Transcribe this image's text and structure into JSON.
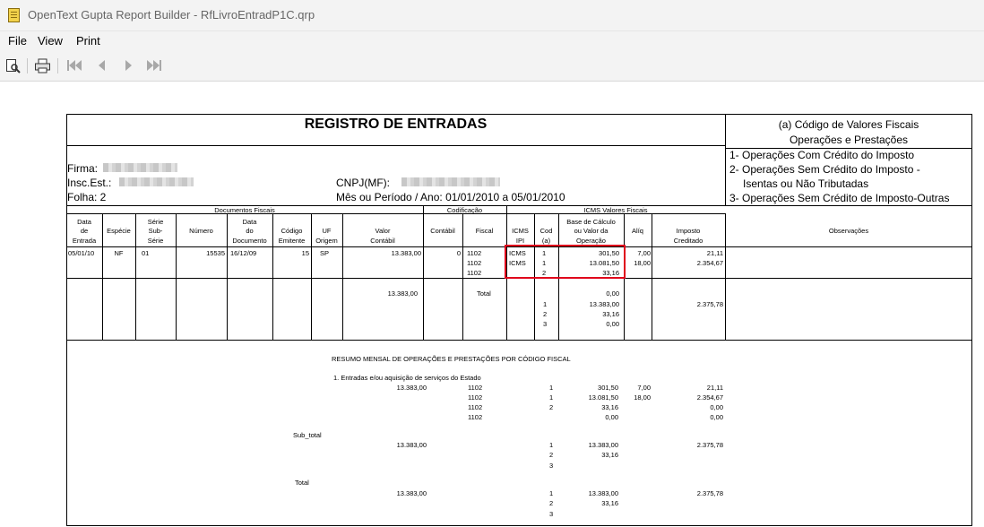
{
  "window": {
    "title": "OpenText Gupta Report Builder - RfLivroEntradP1C.qrp"
  },
  "menu": [
    "File",
    "View",
    "Print"
  ],
  "icons": [
    "preview-icon",
    "printer-icon",
    "first-page-icon",
    "prev-page-icon",
    "next-page-icon",
    "last-page-icon"
  ],
  "header": {
    "title": "REGISTRO DE ENTRADAS",
    "firma_label": "Firma:",
    "insc_label": "Insc.Est.:",
    "folha": "Folha: 2",
    "cnpj_label": "CNPJ(MF):",
    "periodo": "Mês ou Período / Ano:   01/01/2010 a  05/01/2010"
  },
  "legend": {
    "title1": "(a) Código de Valores Fiscais",
    "title2": "Operações e Prestações",
    "items": [
      "1- Operações Com Crédito do Imposto",
      "2- Operações Sem Crédito do Imposto -",
      "Isentas ou Não Tributadas",
      "3- Operações Sem Crédito de Imposto-Outras"
    ]
  },
  "groups": {
    "documentos": "Documentos Fiscais",
    "codificacao": "Codificação",
    "icms": "ICMS Valores Fiscais"
  },
  "columns": {
    "data": [
      "Data",
      "de",
      "Entrada"
    ],
    "especie": "Espécie",
    "serie": [
      "Série",
      "Sub-",
      "Série"
    ],
    "numero": "Número",
    "datadoc": [
      "Data",
      "do",
      "Documento"
    ],
    "codemit": [
      "Código",
      "Emitente"
    ],
    "uf": [
      "UF",
      "Origem"
    ],
    "valor": [
      "Valor",
      "Contábil"
    ],
    "contabil": "Contábil",
    "fiscal": "Fiscal",
    "icmsipi": [
      "ICMS",
      "IPI"
    ],
    "cod": [
      "Cod",
      "(a)"
    ],
    "base": [
      "Base de Cálculo",
      "ou Valor da",
      "Operação"
    ],
    "aliq": "Alíq",
    "imposto": [
      "Imposto",
      "Creditado"
    ],
    "obs": "Observações"
  },
  "entry": {
    "data": "05/01/10",
    "especie": "NF",
    "serie": "01",
    "numero": "15535",
    "datadoc": "16/12/09",
    "codemit": "15",
    "uf": "SP",
    "valor": "13.383,00",
    "contabil": "0",
    "rows": [
      {
        "fiscal": "1102",
        "icms": "ICMS",
        "cod": "1",
        "base": "301,50",
        "aliq": "7,00",
        "imposto": "21,11"
      },
      {
        "fiscal": "1102",
        "icms": "ICMS",
        "cod": "1",
        "base": "13.081,50",
        "aliq": "18,00",
        "imposto": "2.354,67"
      },
      {
        "fiscal": "1102",
        "icms": "",
        "cod": "2",
        "base": "33,16",
        "aliq": "",
        "imposto": ""
      }
    ]
  },
  "totals": {
    "valor": "13.383,00",
    "label": "Total",
    "rows": [
      {
        "cod": "",
        "base": "0,00"
      },
      {
        "cod": "1",
        "base": "13.383,00"
      },
      {
        "cod": "2",
        "base": "33,16"
      },
      {
        "cod": "3",
        "base": "0,00"
      }
    ],
    "imposto": "2.375,78"
  },
  "summary": {
    "title": "RESUMO MENSAL DE OPERAÇÕES E PRESTAÇÕES POR CÓDIGO FISCAL",
    "section": "1. Entradas e/ou aquisição de serviços do Estado",
    "valor": "13.383,00",
    "rows": [
      {
        "fiscal": "1102",
        "cod": "1",
        "base": "301,50",
        "aliq": "7,00",
        "imposto": "21,11"
      },
      {
        "fiscal": "1102",
        "cod": "1",
        "base": "13.081,50",
        "aliq": "18,00",
        "imposto": "2.354,67"
      },
      {
        "fiscal": "1102",
        "cod": "2",
        "base": "33,16",
        "aliq": "",
        "imposto": "0,00"
      },
      {
        "fiscal": "1102",
        "cod": "",
        "base": "0,00",
        "aliq": "",
        "imposto": "0,00"
      }
    ],
    "subtotal_label": "Sub_total",
    "subtotal": {
      "valor": "13.383,00",
      "rows": [
        {
          "cod": "1",
          "base": "13.383,00"
        },
        {
          "cod": "2",
          "base": "33,16"
        },
        {
          "cod": "3",
          "base": ""
        }
      ],
      "imposto": "2.375,78"
    },
    "total_label": "Total",
    "total": {
      "valor": "13.383,00",
      "rows": [
        {
          "cod": "1",
          "base": "13.383,00"
        },
        {
          "cod": "2",
          "base": "33,16"
        },
        {
          "cod": "3",
          "base": ""
        }
      ],
      "imposto": "2.375,78"
    }
  },
  "highlight_color": "#e0001b"
}
